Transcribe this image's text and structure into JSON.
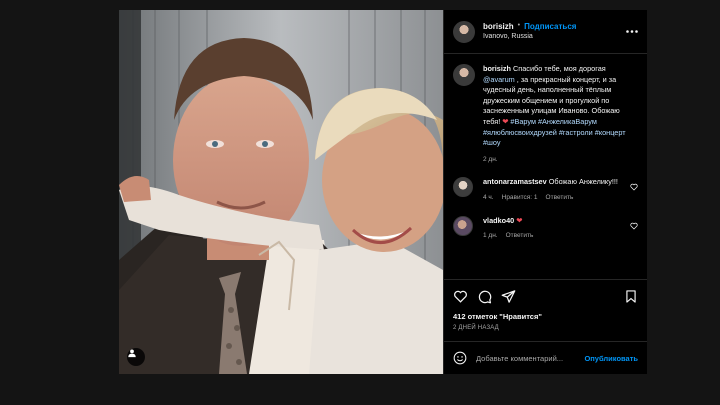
{
  "post": {
    "username": "borisizh",
    "follow_label": "Подписаться",
    "location": "Ivanovo, Russia",
    "caption": {
      "username": "borisizh",
      "part1": " Спасибо тебе, моя дорогая ",
      "mention": "@avarum",
      "part2": " , за прекрасный концерт, и за чудесный день, наполненный тёплым дружеским общением и прогулкой по заснеженным улицам Иваново. Обожаю тебя! ",
      "tags": "#Варум #АнжеликаВарум #ялюблюсвоихдрузей #гастроли #концерт #шоу",
      "age": "2 дн."
    },
    "comments": [
      {
        "username": "antonarzamastsev",
        "text": "Обожаю Анжелику!!!",
        "age": "4 ч.",
        "likes": "Нравится: 1",
        "reply": "Ответить"
      },
      {
        "username": "vladko40",
        "text": "",
        "age": "1 дн.",
        "reply": "Ответить"
      }
    ],
    "likes_text": "412 отметок \"Нравится\"",
    "posted_ago": "2 ДНЕЙ НАЗАД",
    "comment_placeholder": "Добавьте комментарий...",
    "publish_label": "Опубликовать"
  },
  "colors": {
    "link": "#0095f6",
    "heart": "#ed4956",
    "background": "#000000"
  }
}
